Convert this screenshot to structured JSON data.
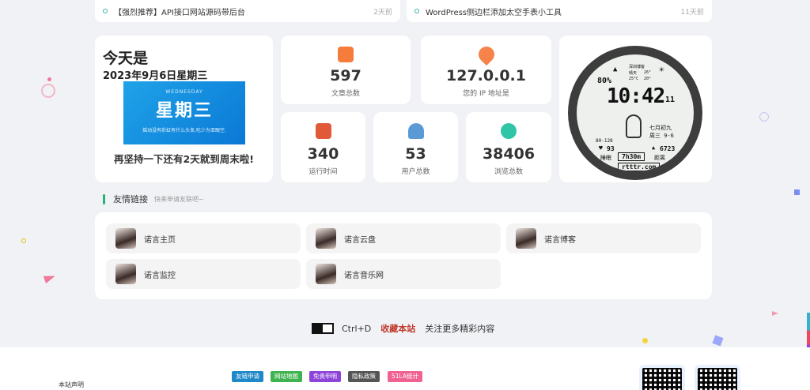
{
  "posts": [
    {
      "title": "【强烈推荐】API接口网站源码带后台",
      "time": "2天前"
    },
    {
      "title": "WordPress侧边栏添加太空手表小工具",
      "time": "11天前"
    }
  ],
  "today": {
    "heading": "今天是",
    "date": "2023年9月6日星期三",
    "banner_en": "WEDNESDAY",
    "banner_cn": "星期三",
    "banner_sub": "摇动没有彩虹有什么头条,吃少为亚眼空.",
    "remain": "再坚持一下还有2天就到周末啦!"
  },
  "stats": [
    {
      "value": "597",
      "label": "文章总数",
      "color": "#f57c3a"
    },
    {
      "value": "127.0.0.1",
      "label": "您的 IP 地址是",
      "color": "#f5834a"
    },
    {
      "value": "340",
      "label": "运行时间",
      "color": "#e05a3a"
    },
    {
      "value": "53",
      "label": "用户总数",
      "color": "#5b9bd5"
    },
    {
      "value": "38406",
      "label": "浏览总数",
      "color": "#2fc6a8"
    }
  ],
  "watch": {
    "weather_line1": "深圳博客",
    "weather_line2": "晴天",
    "temp_top": "26°",
    "temp_low": "25°C",
    "temp_high": "20°",
    "battery": "80%",
    "time": "10:42",
    "seconds": "11",
    "lunar": "七月初九",
    "weekday_date": "周三 9-6",
    "bp": "80-128",
    "heart": "93",
    "steps": "6723",
    "sleep_label": "睡眠",
    "sleep": "7h30m",
    "distance_label": "距离",
    "site": "rtttr.com"
  },
  "friends": {
    "title": "友情链接",
    "hint": "快来申请友联吧~",
    "items": [
      "诺言主页",
      "诺言云盘",
      "诺言博客",
      "诺言监控",
      "诺言音乐网"
    ]
  },
  "ctrl": {
    "keys": "Ctrl+D",
    "fav": "收藏本站",
    "tail": "关注更多精彩内容"
  },
  "footer": {
    "statement": "本站声明",
    "tags": [
      {
        "label": "友链申请",
        "color": "#1e88c9"
      },
      {
        "label": "网站地图",
        "color": "#3fb34f"
      },
      {
        "label": "免责申明",
        "color": "#8e44d8"
      },
      {
        "label": "隐私政策",
        "color": "#555555"
      },
      {
        "label": "51LA统计",
        "color": "#f06292"
      }
    ]
  }
}
